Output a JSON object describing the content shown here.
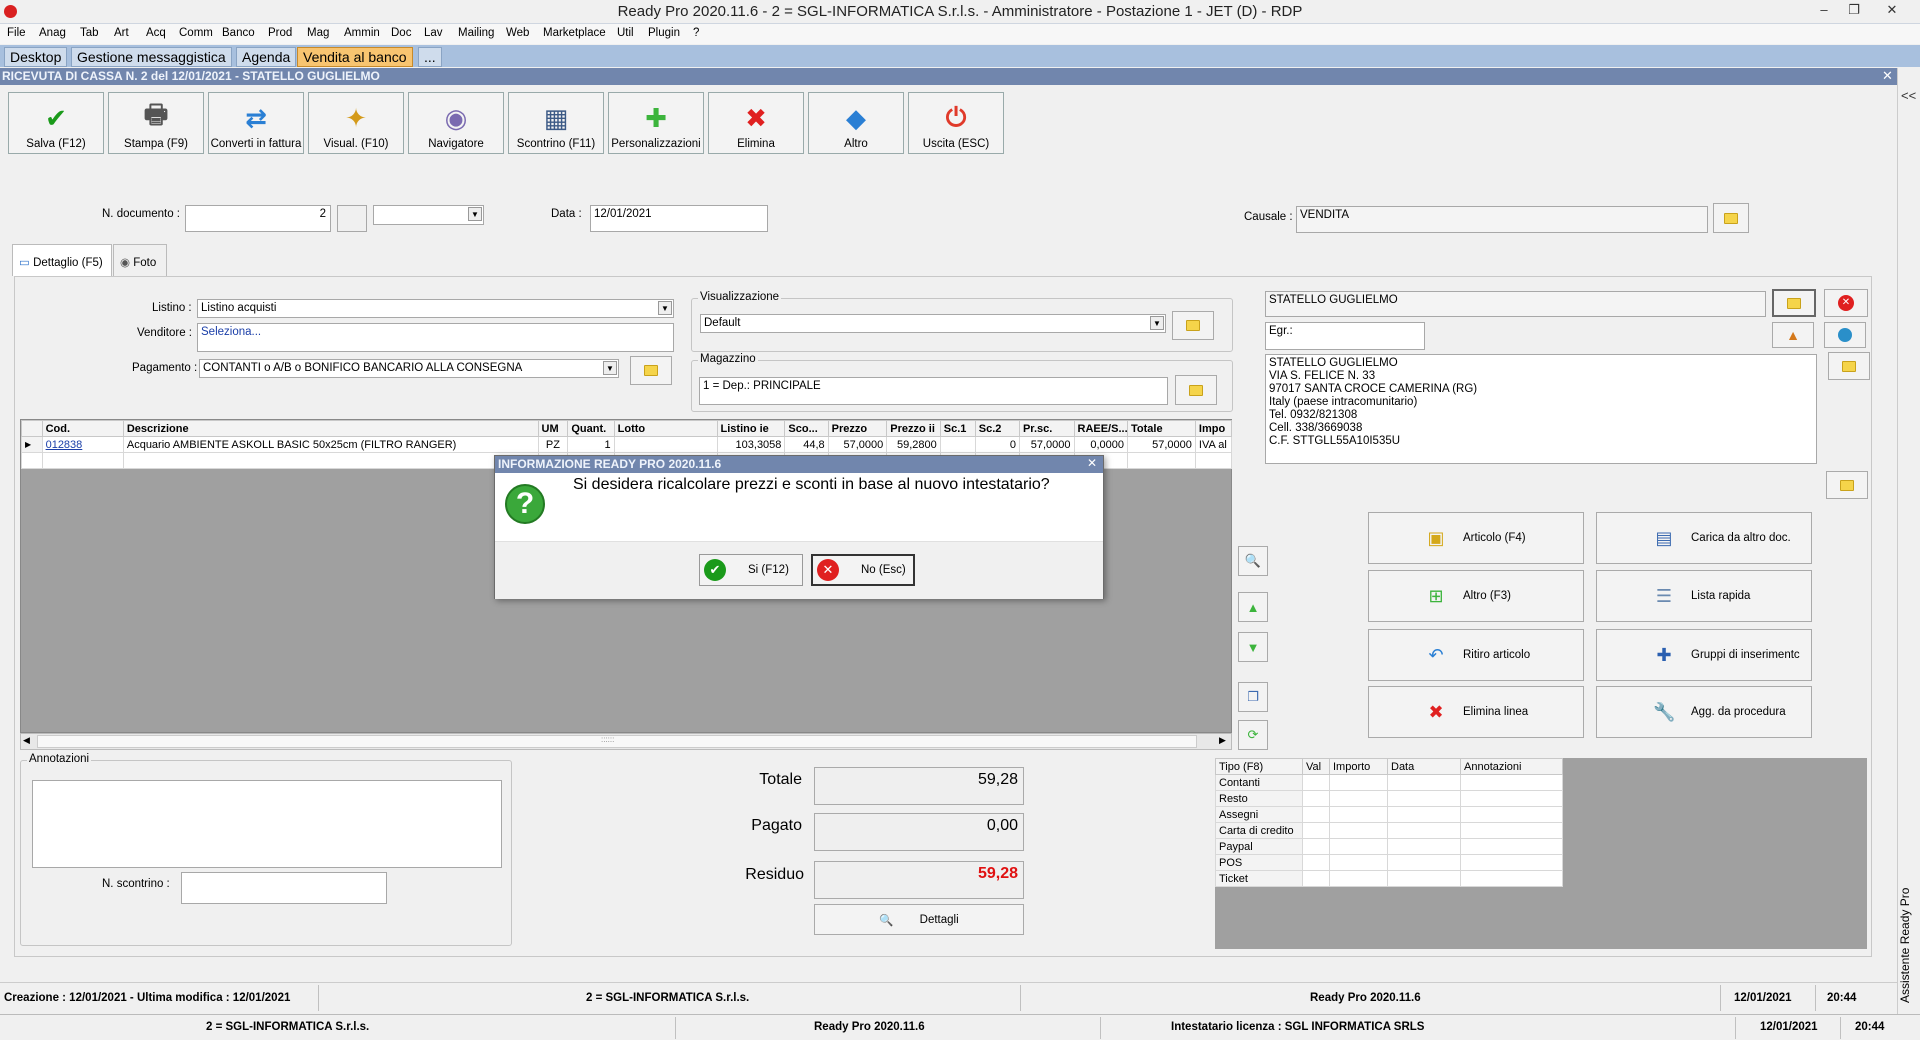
{
  "window": {
    "title": "Ready Pro 2020.11.6 - 2 = SGL-INFORMATICA S.r.l.s. - Amministratore - Postazione 1 - JET (D) - RDP",
    "controls": [
      "–",
      "❐",
      "✕"
    ]
  },
  "menu": [
    "File",
    "Anag",
    "Tab",
    "Art",
    "Acq",
    "Comm",
    "Banco",
    "Prod",
    "Mag",
    "Ammin",
    "Doc",
    "Lav",
    "Mailing",
    "Web",
    "Marketplace",
    "Util",
    "Plugin",
    "?"
  ],
  "app_tabs": [
    {
      "label": "Desktop",
      "active": false
    },
    {
      "label": "Gestione messaggistica",
      "active": false
    },
    {
      "label": "Agenda",
      "active": false
    },
    {
      "label": "Vendita al banco",
      "active": true
    },
    {
      "label": "...",
      "active": false
    }
  ],
  "document": {
    "header": "RICEVUTA DI CASSA N. 2 del 12/01/2021 - STATELLO GUGLIELMO",
    "close": "✕"
  },
  "side_panel": {
    "collapse": "<<",
    "assistant": "Assistente Ready Pro"
  },
  "toolbar": [
    {
      "label": "Salva (F12)",
      "icon": "check-icon",
      "glyph": "✔",
      "color": "#1a9a1a"
    },
    {
      "label": "Stampa (F9)",
      "icon": "printer-icon",
      "glyph": "🖶",
      "color": "#555555"
    },
    {
      "label": "Converti in fattura",
      "icon": "convert-icon",
      "glyph": "⇄",
      "color": "#2a7fd4"
    },
    {
      "label": "Visual. (F10)",
      "icon": "magic-wand-icon",
      "glyph": "✦",
      "color": "#d49a1a"
    },
    {
      "label": "Navigatore",
      "icon": "navigator-icon",
      "glyph": "◉",
      "color": "#7a6ab0"
    },
    {
      "label": "Scontrino (F11)",
      "icon": "cash-register-icon",
      "glyph": "▦",
      "color": "#3c5a86"
    },
    {
      "label": "Personalizzazioni",
      "icon": "puzzle-icon",
      "glyph": "✚",
      "color": "#3cb43c"
    },
    {
      "label": "Elimina",
      "icon": "delete-icon",
      "glyph": "✖",
      "color": "#e02020"
    },
    {
      "label": "Altro",
      "icon": "other-icon",
      "glyph": "◆",
      "color": "#2a7fd4"
    },
    {
      "label": "Uscita (ESC)",
      "icon": "exit-icon",
      "glyph": "⏻",
      "color": "#e03a2a"
    }
  ],
  "doc_fields": {
    "n_documento_label": "N. documento :",
    "n_documento_value": "2",
    "data_label": "Data :",
    "data_value": "12/01/2021",
    "causale_label": "Causale :",
    "causale_value": "VENDITA"
  },
  "sub_tabs": [
    {
      "label": "Dettaglio (F5)",
      "active": true
    },
    {
      "label": "Foto",
      "active": false
    }
  ],
  "form": {
    "listino_label": "Listino :",
    "listino_value": "Listino acquisti",
    "venditore_label": "Venditore :",
    "venditore_value": "Seleziona...",
    "pagamento_label": "Pagamento :",
    "pagamento_value": "CONTANTI o A/B o BONIFICO BANCARIO ALLA CONSEGNA",
    "visualizzazione_label": "Visualizzazione",
    "visualizzazione_value": "Default",
    "magazzino_label": "Magazzino",
    "magazzino_value": "1 = Dep.: PRINCIPALE"
  },
  "customer": {
    "name": "STATELLO GUGLIELMO",
    "title": "Egr.:",
    "address_lines": [
      "STATELLO GUGLIELMO",
      "VIA S. FELICE N. 33",
      "97017 SANTA CROCE CAMERINA (RG)",
      "Italy (paese intracomunitario)",
      "Tel. 0932/821308",
      "Cell. 338/3669038",
      "C.F. STTGLL55A10I535U"
    ]
  },
  "grid": {
    "columns": [
      "Cod.",
      "Descrizione",
      "UM",
      "Quant.",
      "Lotto",
      "Listino ie",
      "Sco...",
      "Prezzo",
      "Prezzo ii",
      "Sc.1",
      "Sc.2",
      "Pr.sc.",
      "RAEE/S...",
      "Totale",
      "Impo"
    ],
    "rows": [
      [
        "012838",
        "Acquario AMBIENTE ASKOLL BASIC 50x25cm (FILTRO RANGER)",
        "PZ",
        "1",
        "",
        "103,3058",
        "44,8",
        "57,0000",
        "59,2800",
        "",
        "0",
        "57,0000",
        "0,0000",
        "57,0000",
        "IVA al"
      ]
    ],
    "scroll_grip": "::::::"
  },
  "dialog": {
    "title": "INFORMAZIONE READY PRO 2020.11.6",
    "close": "✕",
    "icon": "?",
    "message": "Si desidera ricalcolare prezzi e sconti in base al nuovo intestatario?",
    "yes_label": "Si (F12)",
    "no_label": "No (Esc)"
  },
  "action_buttons": [
    {
      "label": "Articolo (F4)",
      "icon": "article-icon",
      "glyph": "▣",
      "color": "#d4a81a"
    },
    {
      "label": "Carica da altro doc.",
      "icon": "load-doc-icon",
      "glyph": "▤",
      "color": "#3c6ab0"
    },
    {
      "label": "Altro (F3)",
      "icon": "add-other-icon",
      "glyph": "⊞",
      "color": "#3cb43c"
    },
    {
      "label": "Lista rapida",
      "icon": "quick-list-icon",
      "glyph": "☰",
      "color": "#6a8ab0"
    },
    {
      "label": "Ritiro articolo",
      "icon": "return-icon",
      "glyph": "↶",
      "color": "#2a7fd4"
    },
    {
      "label": "Gruppi di inserimentc",
      "icon": "groups-icon",
      "glyph": "✚",
      "color": "#2a5fb0"
    },
    {
      "label": "Elimina linea",
      "icon": "delete-line-icon",
      "glyph": "✖",
      "color": "#e02020"
    },
    {
      "label": "Agg. da procedura",
      "icon": "wrench-icon",
      "glyph": "🔧",
      "color": "#777777"
    }
  ],
  "side_tools": [
    {
      "name": "search-small-icon",
      "glyph": "🔍",
      "color": "#3c6ab0"
    },
    {
      "name": "arrow-up-icon",
      "glyph": "▲",
      "color": "#3cb43c"
    },
    {
      "name": "arrow-down-icon",
      "glyph": "▼",
      "color": "#3cb43c"
    },
    {
      "name": "copy-icon",
      "glyph": "❐",
      "color": "#3c6ab0"
    },
    {
      "name": "refresh-icon",
      "glyph": "⟳",
      "color": "#3cb43c"
    }
  ],
  "annotazioni": {
    "label": "Annotazioni",
    "n_scontrino_label": "N. scontrino :"
  },
  "totals": {
    "totale_label": "Totale",
    "totale_value": "59,28",
    "pagato_label": "Pagato",
    "pagato_value": "0,00",
    "residuo_label": "Residuo",
    "residuo_value": "59,28",
    "dettagli_label": "Dettagli"
  },
  "payments": {
    "columns": [
      "Tipo (F8)",
      "Val",
      "Importo",
      "Data",
      "Annotazioni"
    ],
    "types": [
      "Contanti",
      "Resto",
      "Assegni",
      "Carta di credito",
      "Paypal",
      "POS",
      "Ticket"
    ]
  },
  "status1": {
    "created": "Creazione : 12/01/2021 - Ultima modifica : 12/01/2021",
    "company": "2 = SGL-INFORMATICA S.r.l.s.",
    "version": "Ready Pro 2020.11.6",
    "date": "12/01/2021",
    "time": "20:44"
  },
  "status2": {
    "company": "2 = SGL-INFORMATICA S.r.l.s.",
    "version": "Ready Pro 2020.11.6",
    "license": "Intestatario licenza : SGL INFORMATICA SRLS",
    "date": "12/01/2021",
    "time": "20:44"
  },
  "colors": {
    "accent_header": "#7186ad",
    "active_tab": "#f8c470",
    "residuo": "#e01010"
  }
}
